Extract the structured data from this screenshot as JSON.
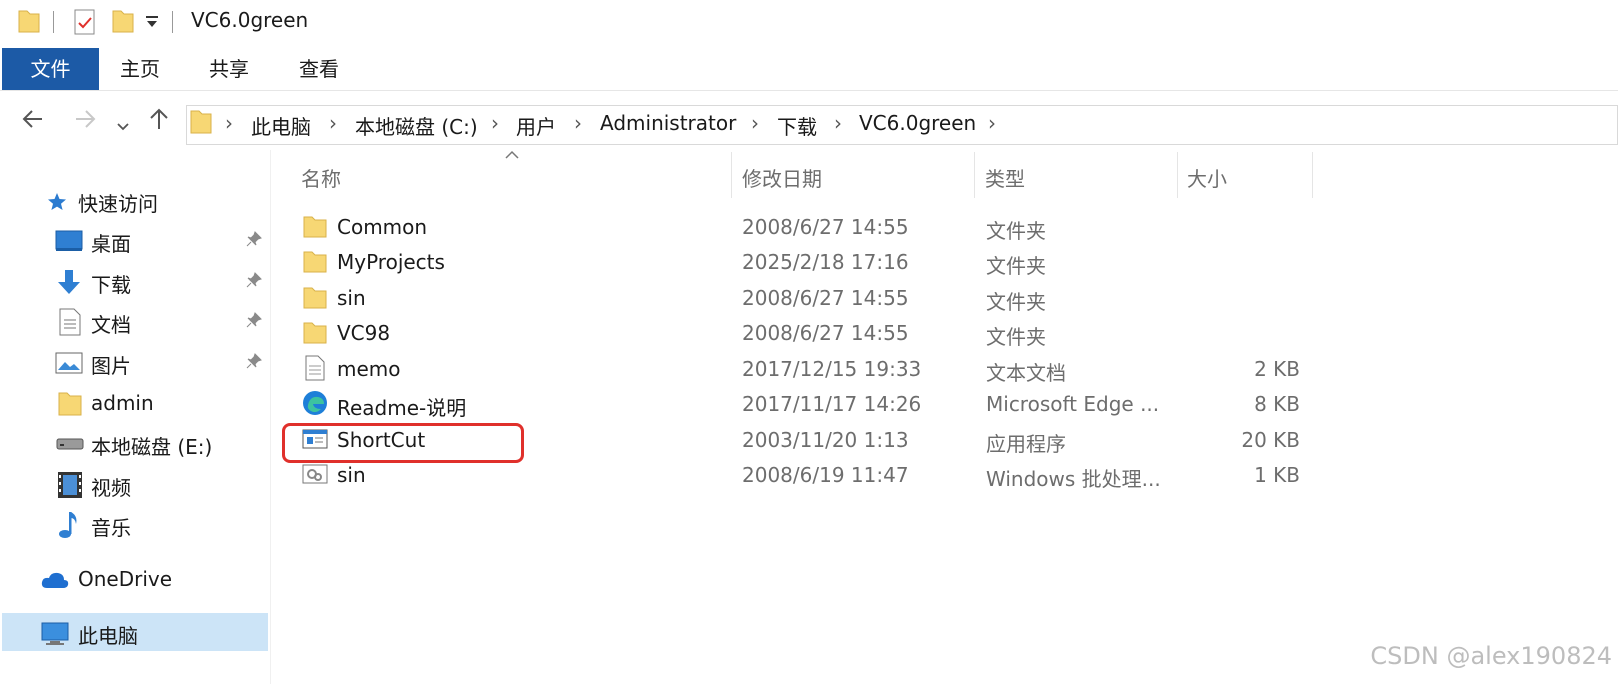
{
  "window": {
    "title": "VC6.0green"
  },
  "ribbon": {
    "file_tab": "文件",
    "tabs": [
      "主页",
      "共享",
      "查看"
    ]
  },
  "address": {
    "crumbs": [
      "此电脑",
      "本地磁盘 (C:)",
      "用户",
      "Administrator",
      "下载",
      "VC6.0green"
    ]
  },
  "sidebar": {
    "quick_access": "快速访问",
    "items": [
      {
        "label": "桌面",
        "icon": "desktop-icon",
        "pinned": true
      },
      {
        "label": "下载",
        "icon": "download-arrow-icon",
        "pinned": true
      },
      {
        "label": "文档",
        "icon": "document-icon",
        "pinned": true
      },
      {
        "label": "图片",
        "icon": "picture-icon",
        "pinned": true
      },
      {
        "label": "admin",
        "icon": "folder-icon",
        "pinned": false
      },
      {
        "label": "本地磁盘 (E:)",
        "icon": "drive-icon",
        "pinned": false
      },
      {
        "label": "视频",
        "icon": "video-icon",
        "pinned": false
      },
      {
        "label": "音乐",
        "icon": "music-icon",
        "pinned": false
      }
    ],
    "onedrive": "OneDrive",
    "this_pc": "此电脑"
  },
  "columns": {
    "name": "名称",
    "date": "修改日期",
    "type": "类型",
    "size": "大小"
  },
  "files": [
    {
      "name": "Common",
      "date": "2008/6/27 14:55",
      "type": "文件夹",
      "size": "",
      "icon": "folder-icon"
    },
    {
      "name": "MyProjects",
      "date": "2025/2/18 17:16",
      "type": "文件夹",
      "size": "",
      "icon": "folder-icon"
    },
    {
      "name": "sin",
      "date": "2008/6/27 14:55",
      "type": "文件夹",
      "size": "",
      "icon": "folder-icon"
    },
    {
      "name": "VC98",
      "date": "2008/6/27 14:55",
      "type": "文件夹",
      "size": "",
      "icon": "folder-icon"
    },
    {
      "name": "memo",
      "date": "2017/12/15 19:33",
      "type": "文本文档",
      "size": "2 KB",
      "icon": "text-file-icon"
    },
    {
      "name": "Readme-说明",
      "date": "2017/11/17 14:26",
      "type": "Microsoft Edge ...",
      "size": "8 KB",
      "icon": "edge-icon"
    },
    {
      "name": "ShortCut",
      "date": "2003/11/20 1:13",
      "type": "应用程序",
      "size": "20 KB",
      "icon": "application-icon"
    },
    {
      "name": "sin",
      "date": "2008/6/19 11:47",
      "type": "Windows 批处理...",
      "size": "1 KB",
      "icon": "batch-file-icon"
    }
  ],
  "watermark": "CSDN @alex190824",
  "colors": {
    "file_tab": "#1c5aa6",
    "folder": "#f7d774",
    "highlight": "#e0302b",
    "selected": "#cce4f7"
  }
}
